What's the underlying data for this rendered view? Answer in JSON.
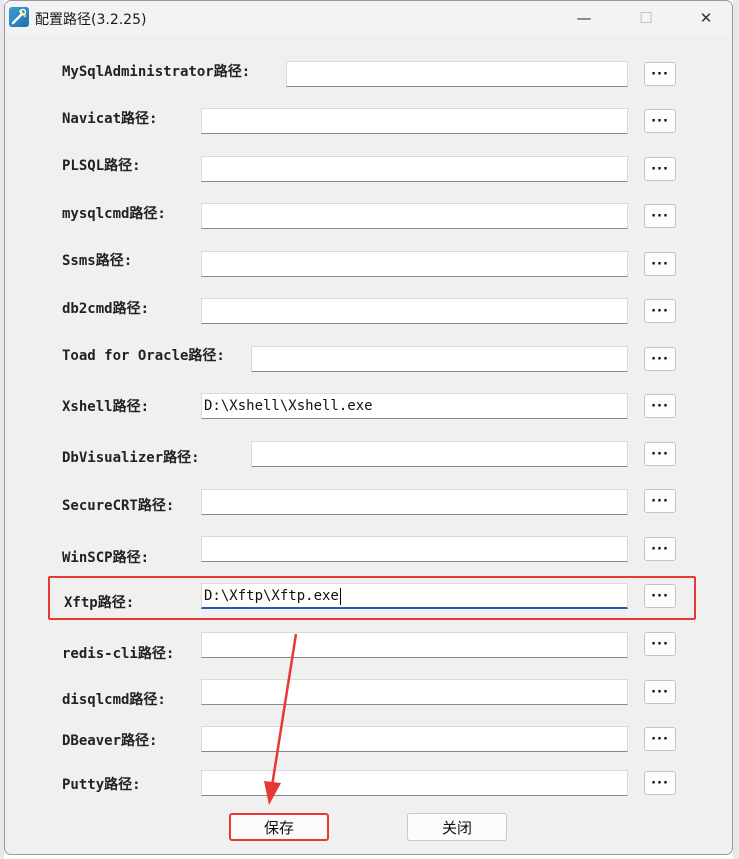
{
  "window": {
    "title": "配置路径(3.2.25)",
    "controls": {
      "minimize": "—",
      "maximize": "☐",
      "close": "✕"
    }
  },
  "rows": [
    {
      "label": "MySqlAdministrator路径:",
      "value": ""
    },
    {
      "label": "Navicat路径:",
      "value": ""
    },
    {
      "label": "PLSQL路径:",
      "value": ""
    },
    {
      "label": "mysqlcmd路径:",
      "value": ""
    },
    {
      "label": "Ssms路径:",
      "value": ""
    },
    {
      "label": "db2cmd路径:",
      "value": ""
    },
    {
      "label": "Toad for Oracle路径:",
      "value": ""
    },
    {
      "label": "Xshell路径:",
      "value": "D:\\Xshell\\Xshell.exe"
    },
    {
      "label": "DbVisualizer路径:",
      "value": ""
    },
    {
      "label": "SecureCRT路径:",
      "value": ""
    },
    {
      "label": "WinSCP路径:",
      "value": ""
    },
    {
      "label": "Xftp路径:",
      "value": "D:\\Xftp\\Xftp.exe"
    },
    {
      "label": "redis-cli路径:",
      "value": ""
    },
    {
      "label": "disqlcmd路径:",
      "value": ""
    },
    {
      "label": "DBeaver路径:",
      "value": ""
    },
    {
      "label": "Putty路径:",
      "value": ""
    }
  ],
  "browse_label": "···",
  "buttons": {
    "save": "保存",
    "close": "关闭"
  },
  "colors": {
    "highlight": "#e53935",
    "focus": "#1e5fa8"
  }
}
